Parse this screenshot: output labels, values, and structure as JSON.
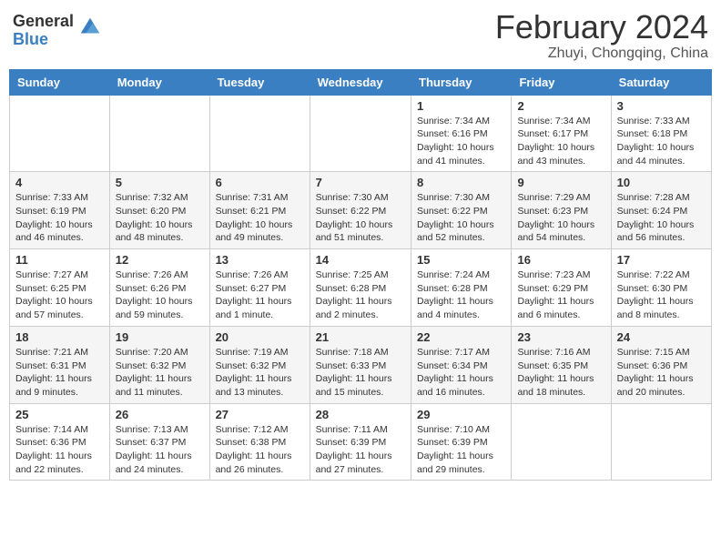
{
  "logo": {
    "general": "General",
    "blue": "Blue"
  },
  "title": {
    "month_year": "February 2024",
    "location": "Zhuyi, Chongqing, China"
  },
  "days_of_week": [
    "Sunday",
    "Monday",
    "Tuesday",
    "Wednesday",
    "Thursday",
    "Friday",
    "Saturday"
  ],
  "weeks": [
    [
      {
        "day": "",
        "info": ""
      },
      {
        "day": "",
        "info": ""
      },
      {
        "day": "",
        "info": ""
      },
      {
        "day": "",
        "info": ""
      },
      {
        "day": "1",
        "info": "Sunrise: 7:34 AM\nSunset: 6:16 PM\nDaylight: 10 hours and 41 minutes."
      },
      {
        "day": "2",
        "info": "Sunrise: 7:34 AM\nSunset: 6:17 PM\nDaylight: 10 hours and 43 minutes."
      },
      {
        "day": "3",
        "info": "Sunrise: 7:33 AM\nSunset: 6:18 PM\nDaylight: 10 hours and 44 minutes."
      }
    ],
    [
      {
        "day": "4",
        "info": "Sunrise: 7:33 AM\nSunset: 6:19 PM\nDaylight: 10 hours and 46 minutes."
      },
      {
        "day": "5",
        "info": "Sunrise: 7:32 AM\nSunset: 6:20 PM\nDaylight: 10 hours and 48 minutes."
      },
      {
        "day": "6",
        "info": "Sunrise: 7:31 AM\nSunset: 6:21 PM\nDaylight: 10 hours and 49 minutes."
      },
      {
        "day": "7",
        "info": "Sunrise: 7:30 AM\nSunset: 6:22 PM\nDaylight: 10 hours and 51 minutes."
      },
      {
        "day": "8",
        "info": "Sunrise: 7:30 AM\nSunset: 6:22 PM\nDaylight: 10 hours and 52 minutes."
      },
      {
        "day": "9",
        "info": "Sunrise: 7:29 AM\nSunset: 6:23 PM\nDaylight: 10 hours and 54 minutes."
      },
      {
        "day": "10",
        "info": "Sunrise: 7:28 AM\nSunset: 6:24 PM\nDaylight: 10 hours and 56 minutes."
      }
    ],
    [
      {
        "day": "11",
        "info": "Sunrise: 7:27 AM\nSunset: 6:25 PM\nDaylight: 10 hours and 57 minutes."
      },
      {
        "day": "12",
        "info": "Sunrise: 7:26 AM\nSunset: 6:26 PM\nDaylight: 10 hours and 59 minutes."
      },
      {
        "day": "13",
        "info": "Sunrise: 7:26 AM\nSunset: 6:27 PM\nDaylight: 11 hours and 1 minute."
      },
      {
        "day": "14",
        "info": "Sunrise: 7:25 AM\nSunset: 6:28 PM\nDaylight: 11 hours and 2 minutes."
      },
      {
        "day": "15",
        "info": "Sunrise: 7:24 AM\nSunset: 6:28 PM\nDaylight: 11 hours and 4 minutes."
      },
      {
        "day": "16",
        "info": "Sunrise: 7:23 AM\nSunset: 6:29 PM\nDaylight: 11 hours and 6 minutes."
      },
      {
        "day": "17",
        "info": "Sunrise: 7:22 AM\nSunset: 6:30 PM\nDaylight: 11 hours and 8 minutes."
      }
    ],
    [
      {
        "day": "18",
        "info": "Sunrise: 7:21 AM\nSunset: 6:31 PM\nDaylight: 11 hours and 9 minutes."
      },
      {
        "day": "19",
        "info": "Sunrise: 7:20 AM\nSunset: 6:32 PM\nDaylight: 11 hours and 11 minutes."
      },
      {
        "day": "20",
        "info": "Sunrise: 7:19 AM\nSunset: 6:32 PM\nDaylight: 11 hours and 13 minutes."
      },
      {
        "day": "21",
        "info": "Sunrise: 7:18 AM\nSunset: 6:33 PM\nDaylight: 11 hours and 15 minutes."
      },
      {
        "day": "22",
        "info": "Sunrise: 7:17 AM\nSunset: 6:34 PM\nDaylight: 11 hours and 16 minutes."
      },
      {
        "day": "23",
        "info": "Sunrise: 7:16 AM\nSunset: 6:35 PM\nDaylight: 11 hours and 18 minutes."
      },
      {
        "day": "24",
        "info": "Sunrise: 7:15 AM\nSunset: 6:36 PM\nDaylight: 11 hours and 20 minutes."
      }
    ],
    [
      {
        "day": "25",
        "info": "Sunrise: 7:14 AM\nSunset: 6:36 PM\nDaylight: 11 hours and 22 minutes."
      },
      {
        "day": "26",
        "info": "Sunrise: 7:13 AM\nSunset: 6:37 PM\nDaylight: 11 hours and 24 minutes."
      },
      {
        "day": "27",
        "info": "Sunrise: 7:12 AM\nSunset: 6:38 PM\nDaylight: 11 hours and 26 minutes."
      },
      {
        "day": "28",
        "info": "Sunrise: 7:11 AM\nSunset: 6:39 PM\nDaylight: 11 hours and 27 minutes."
      },
      {
        "day": "29",
        "info": "Sunrise: 7:10 AM\nSunset: 6:39 PM\nDaylight: 11 hours and 29 minutes."
      },
      {
        "day": "",
        "info": ""
      },
      {
        "day": "",
        "info": ""
      }
    ]
  ]
}
